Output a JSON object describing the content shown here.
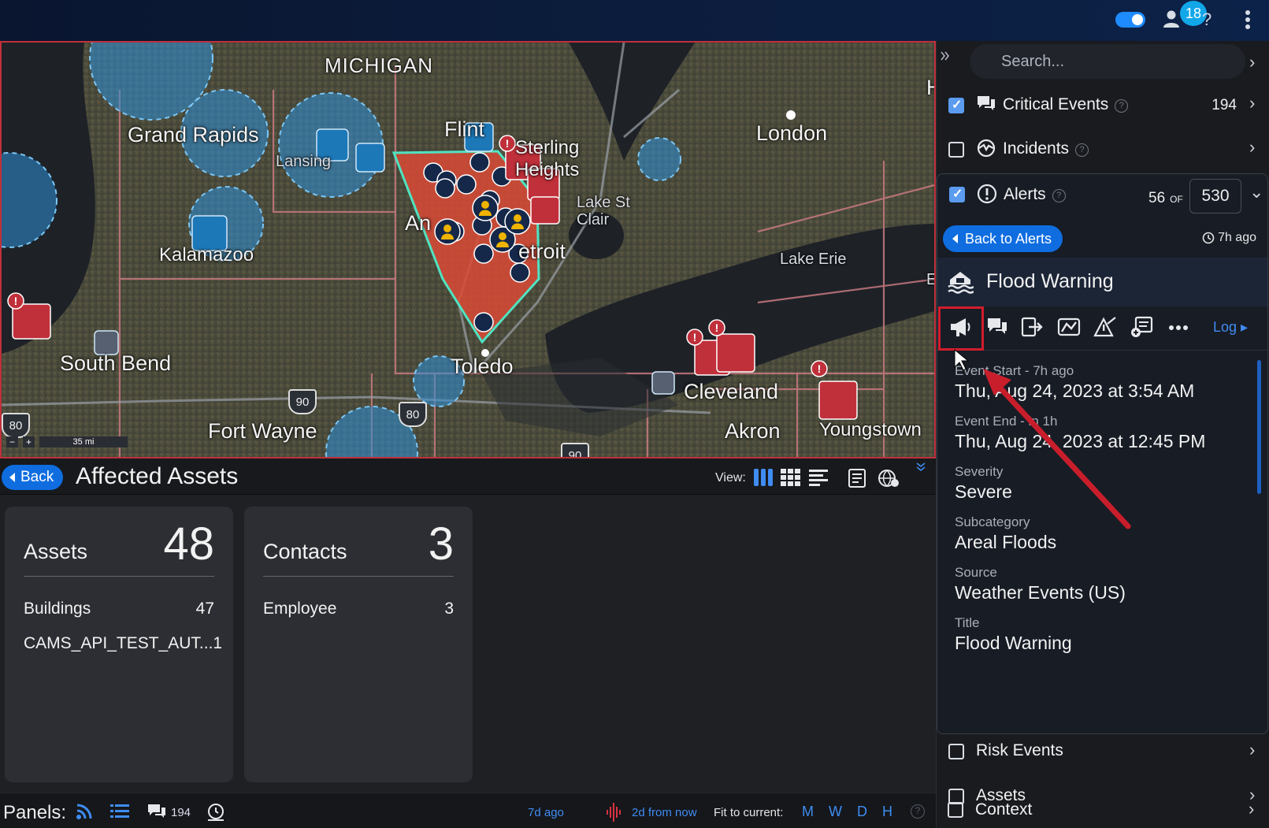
{
  "topbar": {
    "notification_count": "18",
    "help_glyph": "?",
    "toggle_state": "on",
    "icons": [
      "toggle-switch",
      "user-icon",
      "help-icon",
      "kebab-menu-icon"
    ]
  },
  "map": {
    "labels": {
      "state": "MICHIGAN",
      "grand_rapids": "Grand Rapids",
      "lansing": "Lansing",
      "flint": "Flint",
      "sterling_heights": "Sterling Heights",
      "london": "London",
      "lake_st_clair": "Lake St Clair",
      "ann_arbor": "An",
      "detroit": "etroit",
      "kalamazoo": "Kalamazoo",
      "lake_erie": "Lake Erie",
      "south_bend": "South Bend",
      "toledo": "Toledo",
      "cleveland": "Cleveland",
      "fort_wayne": "Fort Wayne",
      "akron": "Akron",
      "youngstown": "Youngstown",
      "edge_h": "H",
      "edge_e": "E"
    },
    "highways": [
      "90",
      "80",
      "80",
      "90"
    ],
    "scale": {
      "minus": "−",
      "plus": "+",
      "distance": "35 mi"
    }
  },
  "assets": {
    "back_label": "Back",
    "title": "Affected Assets",
    "view_label": "View:",
    "cards": [
      {
        "title": "Assets",
        "total": "48",
        "rows": [
          {
            "label": "Buildings",
            "count": "47"
          },
          {
            "label": "CAMS_API_TEST_AUT...",
            "count": "1"
          }
        ]
      },
      {
        "title": "Contacts",
        "total": "3",
        "rows": [
          {
            "label": "Employee",
            "count": "3"
          }
        ]
      }
    ]
  },
  "panels_bar": {
    "label": "Panels:",
    "chat_count": "194",
    "time_ago": "7d ago",
    "time_from": "2d from now",
    "fit_label": "Fit to current:",
    "fit_options": [
      "M",
      "W",
      "D",
      "H"
    ],
    "help": "?"
  },
  "sidebar": {
    "search_placeholder": "Search...",
    "critical_events": {
      "label": "Critical Events",
      "count": "194",
      "checked": true
    },
    "incidents": {
      "label": "Incidents",
      "checked": false
    },
    "alerts": {
      "label": "Alerts",
      "shown": "56",
      "of_label": "OF",
      "total": "530",
      "checked": true,
      "back_label": "Back to Alerts",
      "age": "7h ago"
    },
    "alert_detail": {
      "title": "Flood Warning",
      "log_label": "Log",
      "fields": [
        {
          "label": "Event Start - 7h ago",
          "value": "Thu, Aug 24, 2023 at 3:54 AM"
        },
        {
          "label": "Event End - in 1h",
          "value": "Thu, Aug 24, 2023 at 12:45 PM"
        },
        {
          "label": "Severity",
          "value": "Severe"
        },
        {
          "label": "Subcategory",
          "value": "Areal Floods"
        },
        {
          "label": "Source",
          "value": "Weather Events (US)"
        },
        {
          "label": "Title",
          "value": "Flood Warning"
        }
      ]
    },
    "risk_events": {
      "label": "Risk Events",
      "checked": false
    },
    "assets": {
      "label": "Assets",
      "checked": false
    },
    "context": {
      "label": "Context",
      "checked": false
    }
  },
  "colors": {
    "accent_blue": "#0f6de0",
    "link_blue": "#3f8cf2",
    "highlight_red": "#d21c2c",
    "checkbox_blue": "#5b9bf0"
  }
}
